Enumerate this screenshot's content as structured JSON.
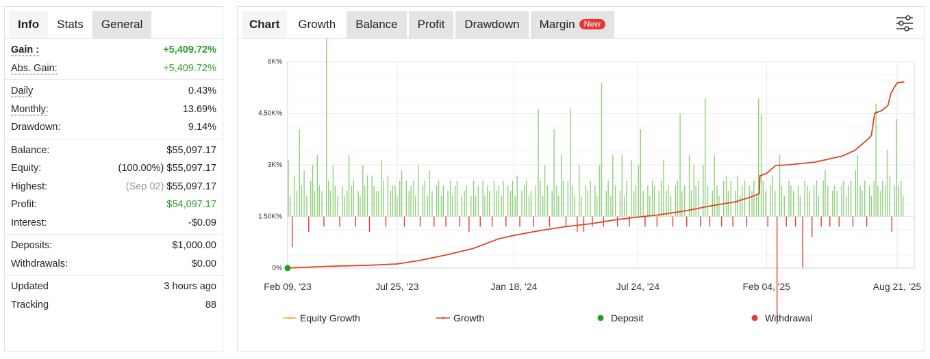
{
  "left_tabs": [
    "Info",
    "Stats",
    "General"
  ],
  "stats": {
    "gain_label": "Gain :",
    "gain_value": "+5,409.72%",
    "abs_gain_label": "Abs. Gain:",
    "abs_gain_value": "+5,409.72%",
    "daily_label": "Daily",
    "daily_value": "0.43%",
    "monthly_label": "Monthly:",
    "monthly_value": "13.69%",
    "drawdown_label": "Drawdown:",
    "drawdown_value": "9.14%",
    "balance_label": "Balance:",
    "balance_value": "$55,097.17",
    "equity_label": "Equity:",
    "equity_pct": "(100.00%)",
    "equity_value": "$55,097.17",
    "highest_label": "Highest:",
    "highest_date": "(Sep 02)",
    "highest_value": "$55,097.17",
    "profit_label": "Profit:",
    "profit_value": "$54,097.17",
    "interest_label": "Interest:",
    "interest_value": "-$0.09",
    "deposits_label": "Deposits:",
    "deposits_value": "$1,000.00",
    "withdrawals_label": "Withdrawals:",
    "withdrawals_value": "$0.00",
    "updated_label": "Updated",
    "updated_value": "3 hours ago",
    "tracking_label": "Tracking",
    "tracking_value": "88"
  },
  "right_tabs": {
    "chart": "Chart",
    "growth": "Growth",
    "balance": "Balance",
    "profit": "Profit",
    "drawdown": "Drawdown",
    "margin": "Margin",
    "new_badge": "New"
  },
  "filter_icon": "sliders-icon",
  "colors": {
    "green": "#2a9d2a",
    "growth_line": "#e0401f",
    "equity_line": "#f5a623",
    "bar_pos": "#8fcf7a",
    "bar_neg": "#e53935",
    "deposit": "#1aa31a",
    "withdrawal": "#e53935",
    "badge": "#e53935"
  },
  "chart_data": {
    "type": "line",
    "y_ticks": [
      "6K%",
      "4.50K%",
      "3K%",
      "1.50K%",
      "0%"
    ],
    "y_tick_values": [
      6000,
      4500,
      3000,
      1500,
      0
    ],
    "ylim": [
      0,
      6000
    ],
    "x_ticks": [
      "Feb 09, '23",
      "Jul 25, '23",
      "Jan 18, '24",
      "Jul 24, '24",
      "Feb 04, '25",
      "Aug 21, '25"
    ],
    "x_tick_days": [
      0,
      166,
      343,
      531,
      726,
      924
    ],
    "x_range_days": [
      0,
      950
    ],
    "grid": true,
    "legend": [
      "Equity Growth",
      "Growth",
      "Deposit",
      "Withdrawal"
    ],
    "legend_position": "bottom",
    "series": [
      {
        "name": "Growth",
        "points": [
          [
            0,
            0
          ],
          [
            60,
            50
          ],
          [
            120,
            80
          ],
          [
            166,
            120
          ],
          [
            200,
            220
          ],
          [
            240,
            380
          ],
          [
            280,
            560
          ],
          [
            320,
            850
          ],
          [
            343,
            950
          ],
          [
            380,
            1080
          ],
          [
            420,
            1200
          ],
          [
            460,
            1290
          ],
          [
            500,
            1410
          ],
          [
            531,
            1480
          ],
          [
            560,
            1540
          ],
          [
            600,
            1650
          ],
          [
            640,
            1800
          ],
          [
            680,
            1930
          ],
          [
            700,
            2050
          ],
          [
            715,
            2160
          ],
          [
            716,
            2680
          ],
          [
            726,
            2750
          ],
          [
            740,
            2980
          ],
          [
            760,
            3000
          ],
          [
            800,
            3080
          ],
          [
            840,
            3250
          ],
          [
            860,
            3420
          ],
          [
            880,
            3750
          ],
          [
            885,
            3850
          ],
          [
            890,
            4500
          ],
          [
            900,
            4570
          ],
          [
            910,
            4720
          ],
          [
            915,
            5100
          ],
          [
            924,
            5380
          ],
          [
            935,
            5410
          ]
        ]
      }
    ],
    "deposit_points": [
      [
        0,
        0
      ]
    ],
    "daily_bars_scale": [
      0,
      1000
    ],
    "daily_bars": [
      [
        1,
        0.55
      ],
      [
        4,
        0.2
      ],
      [
        7,
        -0.3
      ],
      [
        10,
        0.4
      ],
      [
        14,
        0.25
      ],
      [
        18,
        0.85
      ],
      [
        21,
        0.3
      ],
      [
        25,
        0.45
      ],
      [
        29,
        0.2
      ],
      [
        32,
        -0.15
      ],
      [
        35,
        0.35
      ],
      [
        38,
        0.5
      ],
      [
        41,
        0.25
      ],
      [
        45,
        0.6
      ],
      [
        48,
        0.3
      ],
      [
        52,
        0.25
      ],
      [
        55,
        -0.1
      ],
      [
        59,
        1.95
      ],
      [
        62,
        0.35
      ],
      [
        65,
        0.25
      ],
      [
        69,
        0.5
      ],
      [
        72,
        0.3
      ],
      [
        76,
        0.2
      ],
      [
        79,
        -0.1
      ],
      [
        83,
        0.3
      ],
      [
        86,
        0.2
      ],
      [
        90,
        0.25
      ],
      [
        93,
        0.6
      ],
      [
        97,
        0.3
      ],
      [
        100,
        0.35
      ],
      [
        103,
        -0.1
      ],
      [
        107,
        0.25
      ],
      [
        110,
        0.2
      ],
      [
        114,
        0.5
      ],
      [
        117,
        0.3
      ],
      [
        121,
        0.4
      ],
      [
        124,
        -0.15
      ],
      [
        128,
        0.4
      ],
      [
        131,
        0.3
      ],
      [
        135,
        0.25
      ],
      [
        138,
        0.25
      ],
      [
        142,
        0.55
      ],
      [
        145,
        0.35
      ],
      [
        149,
        -0.1
      ],
      [
        152,
        0.4
      ],
      [
        156,
        0.25
      ],
      [
        159,
        0.3
      ],
      [
        163,
        0.3
      ],
      [
        166,
        0.2
      ],
      [
        170,
        0.35
      ],
      [
        173,
        0.45
      ],
      [
        177,
        -0.1
      ],
      [
        180,
        0.35
      ],
      [
        184,
        0.25
      ],
      [
        187,
        0.3
      ],
      [
        191,
        0.35
      ],
      [
        194,
        0.2
      ],
      [
        198,
        0.5
      ],
      [
        201,
        -0.1
      ],
      [
        205,
        0.3
      ],
      [
        208,
        0.35
      ],
      [
        212,
        0.2
      ],
      [
        215,
        0.45
      ],
      [
        219,
        0.25
      ],
      [
        222,
        -0.1
      ],
      [
        226,
        0.3
      ],
      [
        229,
        0.35
      ],
      [
        233,
        0.2
      ],
      [
        236,
        0.3
      ],
      [
        240,
        -0.1
      ],
      [
        243,
        0.25
      ],
      [
        247,
        0.35
      ],
      [
        250,
        0.2
      ],
      [
        254,
        0.3
      ],
      [
        257,
        0.35
      ],
      [
        261,
        -0.1
      ],
      [
        264,
        0.2
      ],
      [
        268,
        0.25
      ],
      [
        271,
        0.3
      ],
      [
        275,
        -0.15
      ],
      [
        278,
        0.2
      ],
      [
        282,
        0.35
      ],
      [
        285,
        0.2
      ],
      [
        289,
        0.3
      ],
      [
        292,
        -0.1
      ],
      [
        296,
        0.35
      ],
      [
        299,
        0.2
      ],
      [
        303,
        0.3
      ],
      [
        306,
        0.25
      ],
      [
        310,
        -0.1
      ],
      [
        313,
        0.35
      ],
      [
        317,
        0.25
      ],
      [
        320,
        0.3
      ],
      [
        324,
        0.2
      ],
      [
        327,
        0.35
      ],
      [
        331,
        -0.1
      ],
      [
        334,
        0.3
      ],
      [
        338,
        0.25
      ],
      [
        341,
        0.35
      ],
      [
        345,
        0.2
      ],
      [
        348,
        0.4
      ],
      [
        352,
        -0.1
      ],
      [
        355,
        0.25
      ],
      [
        359,
        0.3
      ],
      [
        362,
        0.35
      ],
      [
        366,
        0.2
      ],
      [
        369,
        0.25
      ],
      [
        373,
        -0.1
      ],
      [
        376,
        0.3
      ],
      [
        380,
        1.05
      ],
      [
        383,
        0.35
      ],
      [
        387,
        0.2
      ],
      [
        390,
        0.5
      ],
      [
        394,
        0.3
      ],
      [
        397,
        -0.1
      ],
      [
        401,
        0.25
      ],
      [
        404,
        0.85
      ],
      [
        408,
        0.3
      ],
      [
        411,
        0.2
      ],
      [
        415,
        0.6
      ],
      [
        418,
        0.35
      ],
      [
        422,
        -0.1
      ],
      [
        425,
        0.35
      ],
      [
        429,
        1.05
      ],
      [
        432,
        0.3
      ],
      [
        435,
        0.2
      ],
      [
        439,
        -0.15
      ],
      [
        442,
        0.5
      ],
      [
        445,
        0.2
      ],
      [
        449,
        -0.15
      ],
      [
        452,
        0.3
      ],
      [
        455,
        0.25
      ],
      [
        459,
        0.35
      ],
      [
        462,
        -0.1
      ],
      [
        466,
        0.3
      ],
      [
        469,
        0.2
      ],
      [
        473,
        0.5
      ],
      [
        476,
        1.3
      ],
      [
        479,
        -0.1
      ],
      [
        483,
        0.25
      ],
      [
        486,
        0.35
      ],
      [
        490,
        0.2
      ],
      [
        493,
        0.6
      ],
      [
        497,
        0.3
      ],
      [
        500,
        -0.1
      ],
      [
        504,
        0.25
      ],
      [
        507,
        0.6
      ],
      [
        511,
        0.2
      ],
      [
        514,
        0.35
      ],
      [
        518,
        -0.1
      ],
      [
        521,
        0.55
      ],
      [
        525,
        0.25
      ],
      [
        528,
        0.3
      ],
      [
        532,
        0.5
      ],
      [
        535,
        0.85
      ],
      [
        539,
        0.25
      ],
      [
        542,
        -0.1
      ],
      [
        546,
        0.3
      ],
      [
        549,
        0.2
      ],
      [
        553,
        0.35
      ],
      [
        556,
        0.3
      ],
      [
        560,
        -0.1
      ],
      [
        563,
        0.25
      ],
      [
        567,
        0.35
      ],
      [
        570,
        0.55
      ],
      [
        574,
        0.25
      ],
      [
        577,
        0.3
      ],
      [
        581,
        0.2
      ],
      [
        584,
        -0.1
      ],
      [
        588,
        0.3
      ],
      [
        591,
        0.35
      ],
      [
        595,
        1.0
      ],
      [
        598,
        0.25
      ],
      [
        602,
        0.3
      ],
      [
        605,
        -0.1
      ],
      [
        609,
        0.6
      ],
      [
        612,
        0.25
      ],
      [
        616,
        0.5
      ],
      [
        619,
        0.3
      ],
      [
        623,
        0.35
      ],
      [
        626,
        -0.1
      ],
      [
        630,
        0.5
      ],
      [
        633,
        1.15
      ],
      [
        637,
        0.3
      ],
      [
        640,
        -0.1
      ],
      [
        644,
        0.25
      ],
      [
        647,
        0.6
      ],
      [
        651,
        0.3
      ],
      [
        654,
        0.2
      ],
      [
        658,
        -0.1
      ],
      [
        661,
        0.35
      ],
      [
        665,
        0.4
      ],
      [
        668,
        0.25
      ],
      [
        672,
        0.35
      ],
      [
        675,
        -0.1
      ],
      [
        679,
        0.25
      ],
      [
        682,
        0.4
      ],
      [
        686,
        0.2
      ],
      [
        689,
        0.3
      ],
      [
        693,
        0.35
      ],
      [
        696,
        -0.1
      ],
      [
        700,
        0.3
      ],
      [
        704,
        0.25
      ],
      [
        707,
        0.35
      ],
      [
        711,
        0.2
      ],
      [
        714,
        1.15
      ],
      [
        718,
        1.0
      ],
      [
        721,
        0.35
      ],
      [
        725,
        0.25
      ],
      [
        728,
        -0.1
      ],
      [
        732,
        0.3
      ],
      [
        735,
        0.4
      ],
      [
        739,
        0.25
      ],
      [
        742,
        -1.05
      ],
      [
        746,
        0.6
      ],
      [
        749,
        0.3
      ],
      [
        753,
        0.2
      ],
      [
        756,
        -0.1
      ],
      [
        760,
        0.35
      ],
      [
        763,
        0.3
      ],
      [
        767,
        0.25
      ],
      [
        770,
        -0.1
      ],
      [
        774,
        0.3
      ],
      [
        777,
        0.2
      ],
      [
        781,
        -0.5
      ],
      [
        784,
        0.35
      ],
      [
        788,
        0.3
      ],
      [
        791,
        0.25
      ],
      [
        795,
        -0.2
      ],
      [
        798,
        0.3
      ],
      [
        802,
        0.35
      ],
      [
        805,
        0.2
      ],
      [
        809,
        -0.1
      ],
      [
        812,
        0.35
      ],
      [
        815,
        0.45
      ],
      [
        819,
        0.3
      ],
      [
        822,
        -0.1
      ],
      [
        826,
        0.25
      ],
      [
        829,
        0.3
      ],
      [
        833,
        0.25
      ],
      [
        836,
        -0.1
      ],
      [
        840,
        0.3
      ],
      [
        843,
        0.35
      ],
      [
        847,
        0.2
      ],
      [
        850,
        0.3
      ],
      [
        854,
        0.35
      ],
      [
        857,
        -0.1
      ],
      [
        861,
        0.45
      ],
      [
        864,
        0.6
      ],
      [
        868,
        0.3
      ],
      [
        871,
        0.25
      ],
      [
        875,
        0.35
      ],
      [
        878,
        -0.1
      ],
      [
        882,
        0.3
      ],
      [
        885,
        0.2
      ],
      [
        889,
        0.35
      ],
      [
        892,
        1.1
      ],
      [
        895,
        0.3
      ],
      [
        899,
        0.25
      ],
      [
        902,
        0.35
      ],
      [
        906,
        0.3
      ],
      [
        909,
        0.65
      ],
      [
        913,
        0.4
      ],
      [
        916,
        -0.15
      ],
      [
        920,
        0.3
      ],
      [
        923,
        0.95
      ],
      [
        926,
        0.3
      ],
      [
        930,
        0.35
      ],
      [
        933,
        0.2
      ]
    ]
  }
}
